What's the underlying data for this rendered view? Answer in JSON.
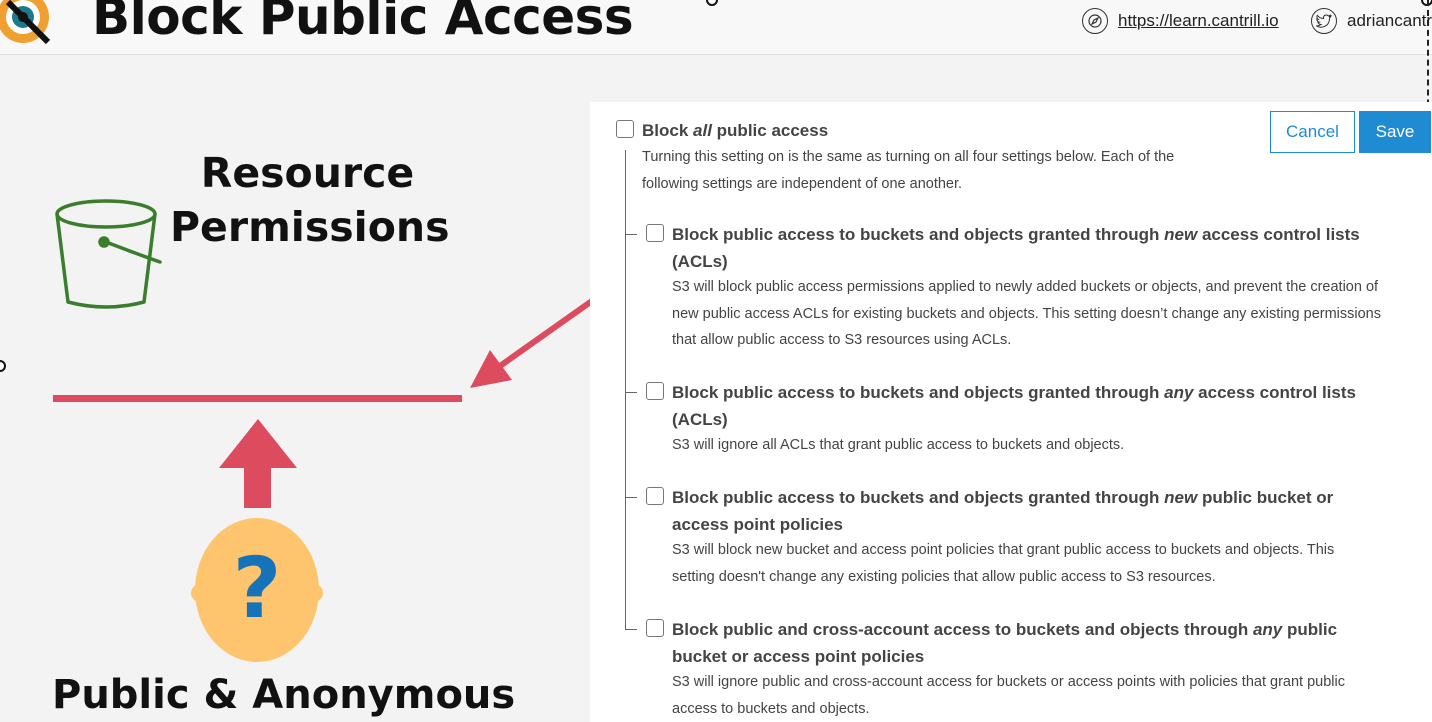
{
  "header": {
    "title": "Block Public Access",
    "link_url": "https://learn.cantrill.io",
    "link_twitter": "adriancantrill"
  },
  "diagram": {
    "resource_label_line1": "Resource",
    "resource_label_line2": "Permissions",
    "public_label": "Public & Anonymous",
    "question_mark": "?"
  },
  "colors": {
    "accent_red": "#dd4b5e",
    "bucket_green": "#3a7d2c",
    "head_yellow": "#ffc56e",
    "question_blue": "#1673b9",
    "button_blue": "#1f8bd3"
  },
  "buttons": {
    "cancel": "Cancel",
    "save": "Save"
  },
  "settings": {
    "master": {
      "title_pre": "Block ",
      "title_em": "all",
      "title_post": " public access",
      "desc_line1": "Turning this setting on is the same as turning on all four settings below. Each of the",
      "desc_line2": "following settings are independent of one another."
    },
    "options": [
      {
        "title_line1_pre": "Block public access to buckets and objects granted through ",
        "title_line1_em": "new",
        "title_line1_post": " access control lists",
        "title_line2": "(ACLs)",
        "desc_lines": [
          "S3 will block public access permissions applied to newly added buckets or objects, and prevent the creation of",
          "new public access ACLs for existing buckets and objects. This setting doesn’t change any existing permissions",
          "that allow public access to S3 resources using ACLs."
        ]
      },
      {
        "title_line1_pre": "Block public access to buckets and objects granted through ",
        "title_line1_em": "any",
        "title_line1_post": " access control lists",
        "title_line2": "(ACLs)",
        "desc_lines": [
          "S3 will ignore all ACLs that grant public access to buckets and objects."
        ]
      },
      {
        "title_line1_pre": "Block public access to buckets and objects granted through ",
        "title_line1_em": "new",
        "title_line1_post": " public bucket or",
        "title_line2": "access point policies",
        "desc_lines": [
          "S3 will block new bucket and access point policies that grant public access to buckets and objects. This",
          "setting doesn't change any existing policies that allow public access to S3 resources."
        ]
      },
      {
        "title_line1_pre": "Block public and cross-account access to buckets and objects through ",
        "title_line1_em": "any",
        "title_line1_post": " public",
        "title_line2": "bucket or access point policies",
        "desc_lines": [
          "S3 will ignore public and cross-account access for buckets or access points with policies that grant public",
          "access to buckets and objects."
        ]
      }
    ]
  }
}
